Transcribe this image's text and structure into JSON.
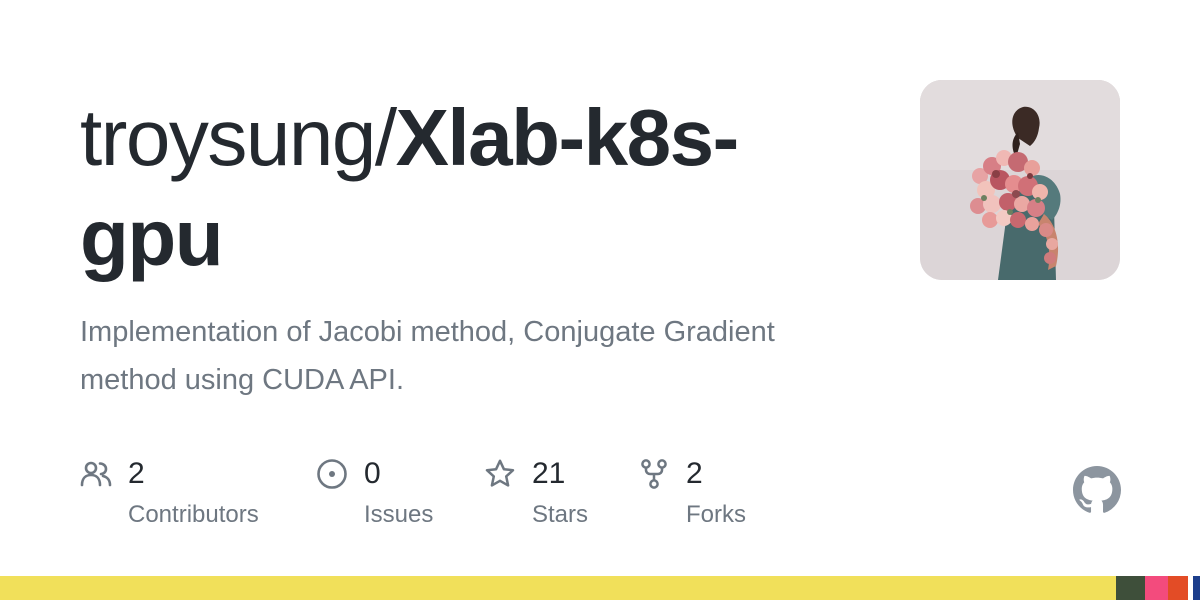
{
  "repo": {
    "owner_prefix": "troysung/",
    "name": "Xlab-k8s-gpu",
    "description": "Implementation of Jacobi method, Conjugate Gradient method using CUDA API."
  },
  "stats": [
    {
      "count": "2",
      "label": "Contributors",
      "icon": "people-icon"
    },
    {
      "count": "0",
      "label": "Issues",
      "icon": "issue-opened-icon"
    },
    {
      "count": "21",
      "label": "Stars",
      "icon": "star-icon"
    },
    {
      "count": "2",
      "label": "Forks",
      "icon": "repo-forked-icon"
    }
  ],
  "colors": {
    "title": "#24292f",
    "muted": "#6e7781",
    "github_logo": "#8c959f"
  },
  "languages": [
    {
      "color": "#f1e05a",
      "share": 0.93
    },
    {
      "color": "#3e4f3a",
      "share": 0.024
    },
    {
      "color": "#f34b7d",
      "share": 0.019
    },
    {
      "color": "#e34c26",
      "share": 0.017
    },
    {
      "color": "#ffffff",
      "share": 0.004
    },
    {
      "color": "#1c3e8c",
      "share": 0.006
    }
  ]
}
